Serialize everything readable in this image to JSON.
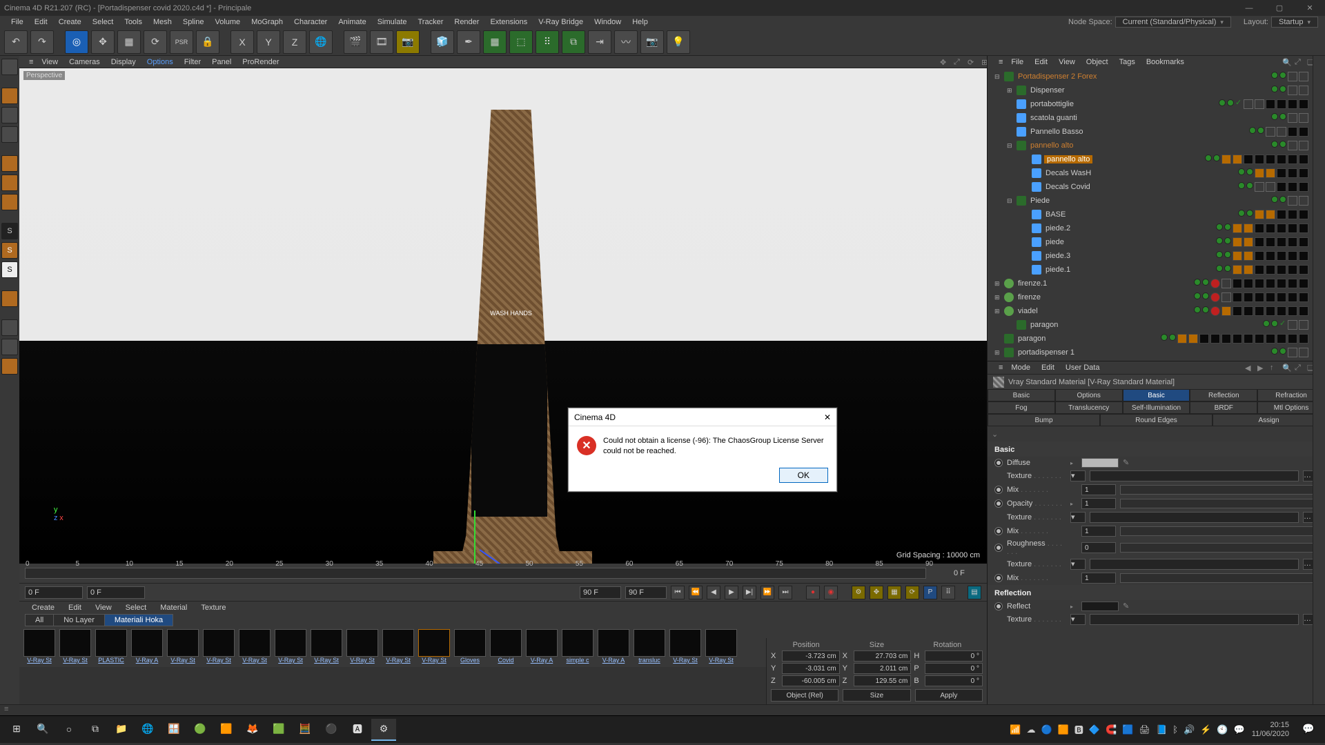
{
  "window": {
    "title": "Cinema 4D R21.207 (RC) - [Portadispenser covid 2020.c4d *] - Principale",
    "controls": {
      "min": "—",
      "max": "▢",
      "close": "✕"
    }
  },
  "main_menu": [
    "File",
    "Edit",
    "Create",
    "Select",
    "Tools",
    "Mesh",
    "Spline",
    "Volume",
    "MoGraph",
    "Character",
    "Animate",
    "Simulate",
    "Tracker",
    "Render",
    "Extensions",
    "V-Ray Bridge",
    "Window",
    "Help"
  ],
  "top_right": {
    "node_space_label": "Node Space:",
    "node_space_value": "Current (Standard/Physical)",
    "layout_label": "Layout:",
    "layout_value": "Startup"
  },
  "view_menu": [
    "View",
    "Cameras",
    "Display",
    "Options",
    "Filter",
    "Panel",
    "ProRender"
  ],
  "viewport": {
    "tag": "Perspective",
    "grid": "Grid Spacing : 10000 cm",
    "prop_label": "WASH HANDS"
  },
  "timeline": {
    "ticks": [
      "0",
      "5",
      "10",
      "15",
      "20",
      "25",
      "30",
      "35",
      "40",
      "45",
      "50",
      "55",
      "60",
      "65",
      "70",
      "75",
      "80",
      "85",
      "90"
    ],
    "end": "0 F",
    "start_field": "0 F",
    "cur_field": "0 F",
    "inA": "90 F",
    "inB": "90 F"
  },
  "materials": {
    "tabs": [
      "Create",
      "Edit",
      "View",
      "Select",
      "Material",
      "Texture"
    ],
    "subtabs": [
      {
        "label": "All",
        "active": false
      },
      {
        "label": "No Layer",
        "active": false
      },
      {
        "label": "Materiali Hoka",
        "active": true
      }
    ],
    "items": [
      "V-Ray St",
      "V-Ray St",
      "PLASTIC",
      "V-Ray A",
      "V-Ray St",
      "V-Ray St",
      "V-Ray St",
      "V-Ray St",
      "V-Ray St",
      "V-Ray St",
      "V-Ray St",
      "V-Ray St",
      "Gloves",
      "Covid",
      "V-Ray A",
      "simple c",
      "V-Ray A",
      "transluc",
      "V-Ray St",
      "V-Ray St"
    ]
  },
  "coords": {
    "headers": [
      "Position",
      "Size",
      "Rotation"
    ],
    "rows": [
      {
        "axis": "X",
        "p": "-3.723 cm",
        "s": "27.703 cm",
        "rA": "H",
        "r": "0 °"
      },
      {
        "axis": "Y",
        "p": "-3.031 cm",
        "s": "2.011 cm",
        "rA": "P",
        "r": "0 °"
      },
      {
        "axis": "Z",
        "p": "-60.005 cm",
        "s": "129.55 cm",
        "rA": "B",
        "r": "0 °"
      }
    ],
    "mode": "Object (Rel)",
    "sizemode": "Size",
    "apply": "Apply"
  },
  "obj_menu": [
    "File",
    "Edit",
    "View",
    "Object",
    "Tags",
    "Bookmarks"
  ],
  "objects": [
    {
      "ind": 0,
      "tw": "⊟",
      "icon": "null",
      "name": "Portadispenser 2 Forex",
      "cls": "org",
      "tags": 2
    },
    {
      "ind": 1,
      "tw": "⊞",
      "icon": "null",
      "name": "Dispenser",
      "tags": 2
    },
    {
      "ind": 1,
      "tw": "",
      "icon": "poly",
      "name": "portabottiglie",
      "tags": 6,
      "chk": true
    },
    {
      "ind": 1,
      "tw": "",
      "icon": "poly",
      "name": "scatola guanti",
      "tags": 2
    },
    {
      "ind": 1,
      "tw": "",
      "icon": "poly",
      "name": "Pannello Basso",
      "tags": 4
    },
    {
      "ind": 1,
      "tw": "⊟",
      "icon": "null",
      "name": "pannello alto",
      "cls": "org",
      "tags": 2
    },
    {
      "ind": 2,
      "tw": "",
      "icon": "poly",
      "name": "pannello alto",
      "cls": "sel",
      "tags": 8,
      "org": true
    },
    {
      "ind": 2,
      "tw": "",
      "icon": "poly",
      "name": "Decals WasH",
      "tags": 5,
      "org": true
    },
    {
      "ind": 2,
      "tw": "",
      "icon": "poly",
      "name": "Decals Covid",
      "tags": 5
    },
    {
      "ind": 1,
      "tw": "⊟",
      "icon": "null",
      "name": "Piede",
      "tags": 2
    },
    {
      "ind": 2,
      "tw": "",
      "icon": "poly",
      "name": "BASE",
      "tags": 5,
      "org": true
    },
    {
      "ind": 2,
      "tw": "",
      "icon": "poly",
      "name": "piede.2",
      "tags": 7,
      "org": true
    },
    {
      "ind": 2,
      "tw": "",
      "icon": "poly",
      "name": "piede",
      "tags": 7,
      "org": true
    },
    {
      "ind": 2,
      "tw": "",
      "icon": "poly",
      "name": "piede.3",
      "tags": 7,
      "org": true
    },
    {
      "ind": 2,
      "tw": "",
      "icon": "poly",
      "name": "piede.1",
      "tags": 7,
      "org": true
    },
    {
      "ind": 0,
      "tw": "⊞",
      "icon": "lamp",
      "name": "firenze.1",
      "tags": 9,
      "red": true
    },
    {
      "ind": 0,
      "tw": "⊞",
      "icon": "lamp",
      "name": "firenze",
      "tags": 9,
      "red": true
    },
    {
      "ind": 0,
      "tw": "⊞",
      "icon": "lamp",
      "name": "viadel",
      "tags": 9,
      "red": true,
      "orgchip": true
    },
    {
      "ind": 1,
      "tw": "",
      "icon": "null",
      "name": "paragon",
      "tags": 2,
      "chk": true
    },
    {
      "ind": 0,
      "tw": "",
      "icon": "null",
      "name": "paragon",
      "tags": 12,
      "org": true
    },
    {
      "ind": 0,
      "tw": "⊞",
      "icon": "null",
      "name": "portadispenser 1",
      "tags": 2
    }
  ],
  "attr_menu": [
    "Mode",
    "Edit",
    "User Data"
  ],
  "attr_header": "Vray Standard Material [V-Ray Standard Material]",
  "attr_tabs": [
    {
      "l": "Basic"
    },
    {
      "l": "Options"
    },
    {
      "l": "Basic",
      "a": true
    },
    {
      "l": "Reflection"
    },
    {
      "l": "Refraction"
    },
    {
      "l": "Fog"
    },
    {
      "l": "Translucency"
    },
    {
      "l": "Self-Illumination"
    },
    {
      "l": "BRDF"
    },
    {
      "l": "Mtl Options"
    },
    {
      "l": "Bump"
    },
    {
      "l": "Round Edges"
    },
    {
      "l": "Assign"
    }
  ],
  "attr_sections": {
    "basic": "Basic",
    "reflection": "Reflection"
  },
  "attr_params": [
    {
      "sec": "basic",
      "type": "color",
      "label": "Diffuse",
      "on": true,
      "tri": true
    },
    {
      "sec": "basic",
      "type": "tex",
      "label": "Texture"
    },
    {
      "sec": "basic",
      "type": "mix",
      "label": "Mix",
      "val": "1",
      "on": true
    },
    {
      "sec": "basic",
      "type": "mix",
      "label": "Opacity",
      "val": "1",
      "on": true,
      "tri": true
    },
    {
      "sec": "basic",
      "type": "tex",
      "label": "Texture"
    },
    {
      "sec": "basic",
      "type": "mix",
      "label": "Mix",
      "val": "1",
      "on": true
    },
    {
      "sec": "basic",
      "type": "mix",
      "label": "Roughness",
      "val": "0",
      "on": true
    },
    {
      "sec": "basic",
      "type": "tex",
      "label": "Texture"
    },
    {
      "sec": "basic",
      "type": "mix",
      "label": "Mix",
      "val": "1",
      "on": true
    },
    {
      "sec": "reflection",
      "type": "color",
      "label": "Reflect",
      "dark": true,
      "on": true,
      "tri": true
    },
    {
      "sec": "reflection",
      "type": "tex",
      "label": "Texture"
    }
  ],
  "modal": {
    "title": "Cinema 4D",
    "message": "Could not obtain a license (-96): The ChaosGroup License Server could not be reached.",
    "ok": "OK"
  },
  "taskbar": {
    "apps": [
      "⊞",
      "🔍",
      "○",
      "⧉",
      "📁",
      "🌐",
      "🪟",
      "🟢",
      "🟧",
      "🦊",
      "🟩",
      "🧮",
      "⚫",
      "🅰",
      "⚙"
    ],
    "tray_icons": [
      "📶",
      "☁",
      "🔵",
      "🟧",
      "🅱",
      "🔷",
      "🧲",
      "🟦",
      "🖨",
      "📘",
      "ᛒ",
      "🔊",
      "⚡",
      "🕙",
      "💬"
    ],
    "time": "20:15",
    "date": "11/06/2020"
  }
}
